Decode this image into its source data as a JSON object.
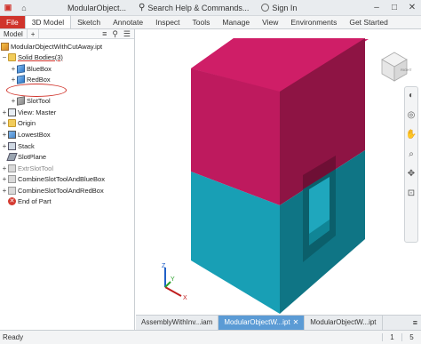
{
  "titlebar": {
    "title": "ModularObject...",
    "search_label": "Search Help & Commands...",
    "signin_label": "Sign In"
  },
  "ribbon": {
    "tabs": [
      "File",
      "3D Model",
      "Sketch",
      "Annotate",
      "Inspect",
      "Tools",
      "Manage",
      "View",
      "Environments",
      "Get Started"
    ]
  },
  "browser": {
    "tab_label": "Model",
    "add_symbol": "+",
    "tree": [
      {
        "label": "ModularObjectWithCutAway.ipt",
        "icon": "part-icon",
        "expander": ""
      },
      {
        "label": "Solid Bodies(3)",
        "icon": "folder-icon",
        "expander": "−"
      },
      {
        "label": "BlueBox",
        "icon": "solid-body-icon",
        "expander": "+"
      },
      {
        "label": "RedBox",
        "icon": "solid-body-icon",
        "expander": "+"
      },
      {
        "label": "SlotTool",
        "icon": "solid-body-icon",
        "expander": "+"
      },
      {
        "label": "View: Master",
        "icon": "view-icon",
        "expander": "+"
      },
      {
        "label": "Origin",
        "icon": "folder-icon",
        "expander": "+"
      },
      {
        "label": "LowestBox",
        "icon": "extrude-icon",
        "expander": "+"
      },
      {
        "label": "Stack",
        "icon": "stack-icon",
        "expander": "+"
      },
      {
        "label": "SlotPlane",
        "icon": "workplane-icon",
        "expander": ""
      },
      {
        "label": "ExtrSlotTool",
        "icon": "extrude-gray-icon",
        "expander": "+"
      },
      {
        "label": "CombineSlotToolAndBlueBox",
        "icon": "combine-icon",
        "expander": "+"
      },
      {
        "label": "CombineSlotToolAndRedBox",
        "icon": "combine-icon",
        "expander": "+"
      },
      {
        "label": "End of Part",
        "icon": "end-of-part-icon",
        "expander": ""
      }
    ]
  },
  "colors": {
    "red_box_top": "#d01f69",
    "red_box_front": "#be1a5e",
    "red_box_side": "#8e1444",
    "blue_box_front": "#189fb5",
    "blue_box_side": "#0f7585",
    "file_tab": "#d0342c",
    "active_doc_tab": "#5b9bd5"
  },
  "viewcube": {
    "face_label": "RIGHT"
  },
  "triad": {
    "x": "X",
    "y": "Y",
    "z": "Z"
  },
  "doc_tabs": [
    {
      "label": "AssemblyWithInv...iam",
      "active": false
    },
    {
      "label": "ModularObjectW...ipt",
      "active": true
    },
    {
      "label": "ModularObjectW...ipt",
      "active": false
    }
  ],
  "status": {
    "ready": "Ready",
    "count1": "1",
    "count2": "5"
  }
}
